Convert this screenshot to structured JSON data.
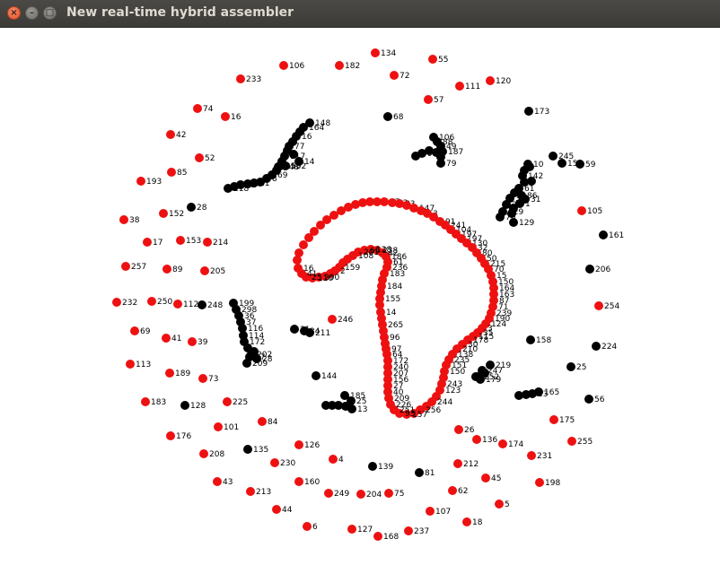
{
  "window": {
    "title": "New real-time hybrid assembler",
    "close_glyph": "×",
    "minimize_glyph": "–",
    "maximize_glyph": "□"
  },
  "colors": {
    "red": "#ee1111",
    "black": "#000000"
  },
  "red_nodes": [
    {
      "label": "134"
    },
    {
      "label": "55"
    },
    {
      "label": "106"
    },
    {
      "label": "182"
    },
    {
      "label": "72"
    },
    {
      "label": "233"
    },
    {
      "label": "111"
    },
    {
      "label": "120"
    },
    {
      "label": "57"
    },
    {
      "label": "74"
    },
    {
      "label": "16"
    },
    {
      "label": "42"
    },
    {
      "label": "52"
    },
    {
      "label": "85"
    },
    {
      "label": "193"
    },
    {
      "label": "105"
    },
    {
      "label": "152"
    },
    {
      "label": "38"
    },
    {
      "label": "17"
    },
    {
      "label": "153"
    },
    {
      "label": "214"
    },
    {
      "label": "257"
    },
    {
      "label": "89"
    },
    {
      "label": "205"
    },
    {
      "label": "232"
    },
    {
      "label": "250"
    },
    {
      "label": "112"
    },
    {
      "label": "254"
    },
    {
      "label": "246"
    },
    {
      "label": "69"
    },
    {
      "label": "41"
    },
    {
      "label": "39"
    },
    {
      "label": "113"
    },
    {
      "label": "189"
    },
    {
      "label": "73"
    },
    {
      "label": "183"
    },
    {
      "label": "225"
    },
    {
      "label": "101"
    },
    {
      "label": "84"
    },
    {
      "label": "175"
    },
    {
      "label": "26"
    },
    {
      "label": "176"
    },
    {
      "label": "136"
    },
    {
      "label": "174"
    },
    {
      "label": "255"
    },
    {
      "label": "126"
    },
    {
      "label": "208"
    },
    {
      "label": "231"
    },
    {
      "label": "230"
    },
    {
      "label": "4"
    },
    {
      "label": "212"
    },
    {
      "label": "45"
    },
    {
      "label": "198"
    },
    {
      "label": "43"
    },
    {
      "label": "160"
    },
    {
      "label": "213"
    },
    {
      "label": "249"
    },
    {
      "label": "204"
    },
    {
      "label": "75"
    },
    {
      "label": "62"
    },
    {
      "label": "5"
    },
    {
      "label": "44"
    },
    {
      "label": "107"
    },
    {
      "label": "18"
    },
    {
      "label": "6"
    },
    {
      "label": "127"
    },
    {
      "label": "168"
    },
    {
      "label": "237"
    }
  ],
  "black_nodes": [
    {
      "label": "68"
    },
    {
      "label": "173"
    },
    {
      "label": "28"
    },
    {
      "label": "161"
    },
    {
      "label": "206"
    },
    {
      "label": "248"
    },
    {
      "label": "158"
    },
    {
      "label": "224"
    },
    {
      "label": "144"
    },
    {
      "label": "25"
    },
    {
      "label": "56"
    },
    {
      "label": "128"
    },
    {
      "label": "135"
    },
    {
      "label": "139"
    },
    {
      "label": "81"
    }
  ],
  "black_clusters": [
    {
      "labels": [
        "148",
        "164",
        "16",
        "77",
        "117",
        "253",
        "69",
        "8",
        "21",
        "22",
        "218",
        "14",
        "248",
        "102"
      ]
    },
    {
      "labels": [
        "106",
        "88",
        "49",
        "187",
        "79",
        "91"
      ]
    },
    {
      "labels": [
        "245",
        "59",
        "152",
        "10",
        "142",
        "61",
        "34",
        "29",
        "229",
        "129",
        "1",
        "31",
        "86",
        "70"
      ]
    },
    {
      "labels": [
        "199",
        "298",
        "36",
        "37",
        "116",
        "114",
        "172",
        "202",
        "28",
        "209",
        "57"
      ]
    },
    {
      "labels": [
        "34",
        "21",
        "211"
      ]
    },
    {
      "labels": [
        "185",
        "25",
        "220",
        "13"
      ]
    },
    {
      "labels": [
        "219",
        "247",
        "252",
        "179"
      ]
    },
    {
      "labels": [
        "165",
        "23",
        "14"
      ]
    }
  ],
  "loop_labels": [
    "97",
    "92",
    "83",
    "147",
    "3",
    "91",
    "241",
    "104",
    "197",
    "197",
    "130",
    "32",
    "80",
    "50",
    "215",
    "70",
    "15",
    "150",
    "164",
    "163",
    "87",
    "71",
    "239",
    "190",
    "124",
    "3",
    "35",
    "115",
    "178",
    "30",
    "210",
    "138",
    "235",
    "151",
    "150",
    "243",
    "123",
    "244",
    "256",
    "157",
    "93",
    "251",
    "226",
    "209",
    "40",
    "27",
    "156",
    "207",
    "240",
    "172",
    "64",
    "97",
    "96",
    "265",
    "14",
    "155",
    "184",
    "183",
    "236",
    "61",
    "186",
    "42",
    "238",
    "128",
    "66",
    "201",
    "108",
    "159",
    "2",
    "200",
    "110",
    "25",
    "41",
    "16",
    "0"
  ]
}
